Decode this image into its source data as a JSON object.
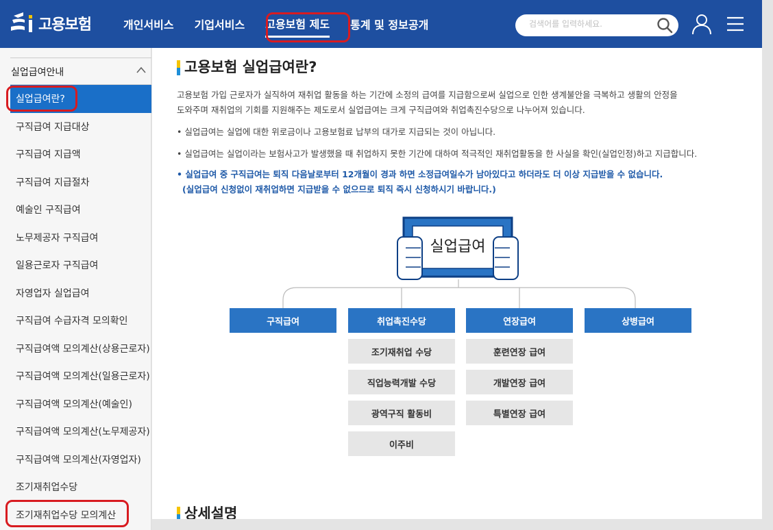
{
  "header": {
    "logo_text": "고용보험",
    "nav": [
      "개인서비스",
      "기업서비스",
      "고용보험 제도",
      "통계 및 정보공개"
    ],
    "active_nav_index": 2,
    "search_placeholder": "검색어를 입력하세요."
  },
  "sidebar": {
    "heading": "실업급여안내",
    "items": [
      "실업급여란?",
      "구직급여 지급대상",
      "구직급여 지급액",
      "구직급여 지급절차",
      "예술인 구직급여",
      "노무제공자 구직급여",
      "일용근로자 구직급여",
      "자영업자 실업급여",
      "구직급여 수급자격 모의확인",
      "구직급여액 모의계산(상용근로자)",
      "구직급여액 모의계산(일용근로자)",
      "구직급여액 모의계산(예술인)",
      "구직급여액 모의계산(노무제공자)",
      "구직급여액 모의계산(자영업자)",
      "조기재취업수당",
      "조기재취업수당 모의계산"
    ],
    "active_index": 0
  },
  "main": {
    "title": "고용보험 실업급여란?",
    "intro_line1": "고용보험 가입 근로자가 실직하여 재취업 활동을 하는 기간에 소정의 급여를 지급함으로써 실업으로 인한 생계불안을 극복하고 생활의 안정을",
    "intro_line2": "도와주며 재취업의 기회를 지원해주는 제도로서 실업급여는 크게 구직급여와 취업촉진수당으로 나누어져 있습니다.",
    "bullet1": "실업급여는 실업에 대한 위로금이나 고용보험료 납부의 대가로 지급되는 것이 아닙니다.",
    "bullet2": "실업급여는 실업이라는 보험사고가 발생했을 때 취업하지 못한 기간에 대하여 적극적인 재취업활동을 한 사실을 확인(실업인정)하고 지급합니다.",
    "notice_line1": "실업급여 중 구직급여는 퇴직 다음날로부터 12개월이 경과 하면 소정급여일수가 남아있다고 하더라도 더 이상 지급받을 수 없습니다.",
    "notice_line2": "(실업급여 신청없이 재취업하면 지급받을 수 없으므로 퇴직 즉시 신청하시기 바랍니다.)",
    "diagram": {
      "root": "실업급여",
      "categories": [
        "구직급여",
        "취업촉진수당",
        "연장급여",
        "상병급여"
      ],
      "promotion_items": [
        "조기재취업 수당",
        "직업능력개발 수당",
        "광역구직 활동비",
        "이주비"
      ],
      "extension_items": [
        "훈련연장 급여",
        "개발연장 급여",
        "특별연장 급여"
      ]
    },
    "section2_title": "상세설명"
  },
  "colors": {
    "header_bg": "#1e4fa0",
    "active_sidebar": "#1a6fc8",
    "category_box": "#2a74c4",
    "notice_text": "#1f5aa8",
    "highlight_outline": "#d81b20"
  }
}
